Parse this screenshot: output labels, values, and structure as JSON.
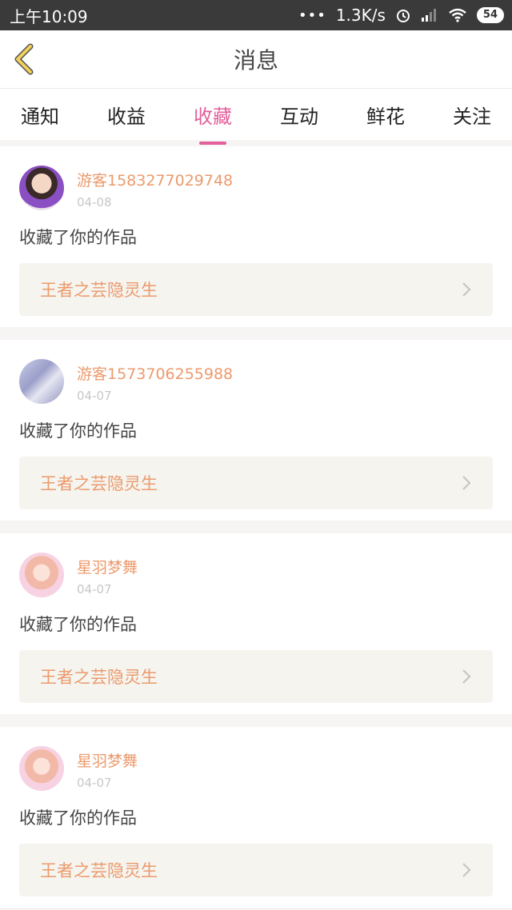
{
  "status": {
    "time": "上午10:09",
    "dots": "•••",
    "speed": "1.3K/s",
    "battery": "54"
  },
  "header": {
    "title": "消息"
  },
  "tabs": [
    {
      "label": "通知"
    },
    {
      "label": "收益"
    },
    {
      "label": "收藏"
    },
    {
      "label": "互动"
    },
    {
      "label": "鲜花"
    },
    {
      "label": "关注"
    }
  ],
  "active_tab": "收藏",
  "items": [
    {
      "user": "游客1583277029748",
      "date": "04-08",
      "action": "收藏了你的作品",
      "work": "王者之芸隐灵生"
    },
    {
      "user": "游客1573706255988",
      "date": "04-07",
      "action": "收藏了你的作品",
      "work": "王者之芸隐灵生"
    },
    {
      "user": "星羽梦舞",
      "date": "04-07",
      "action": "收藏了你的作品",
      "work": "王者之芸隐灵生"
    },
    {
      "user": "星羽梦舞",
      "date": "04-07",
      "action": "收藏了你的作品",
      "work": "王者之芸隐灵生"
    }
  ],
  "colors": {
    "accent_pink": "#e35f9c",
    "name_orange": "#ec9a6c",
    "back_arrow_yellow": "#f2d15b"
  }
}
